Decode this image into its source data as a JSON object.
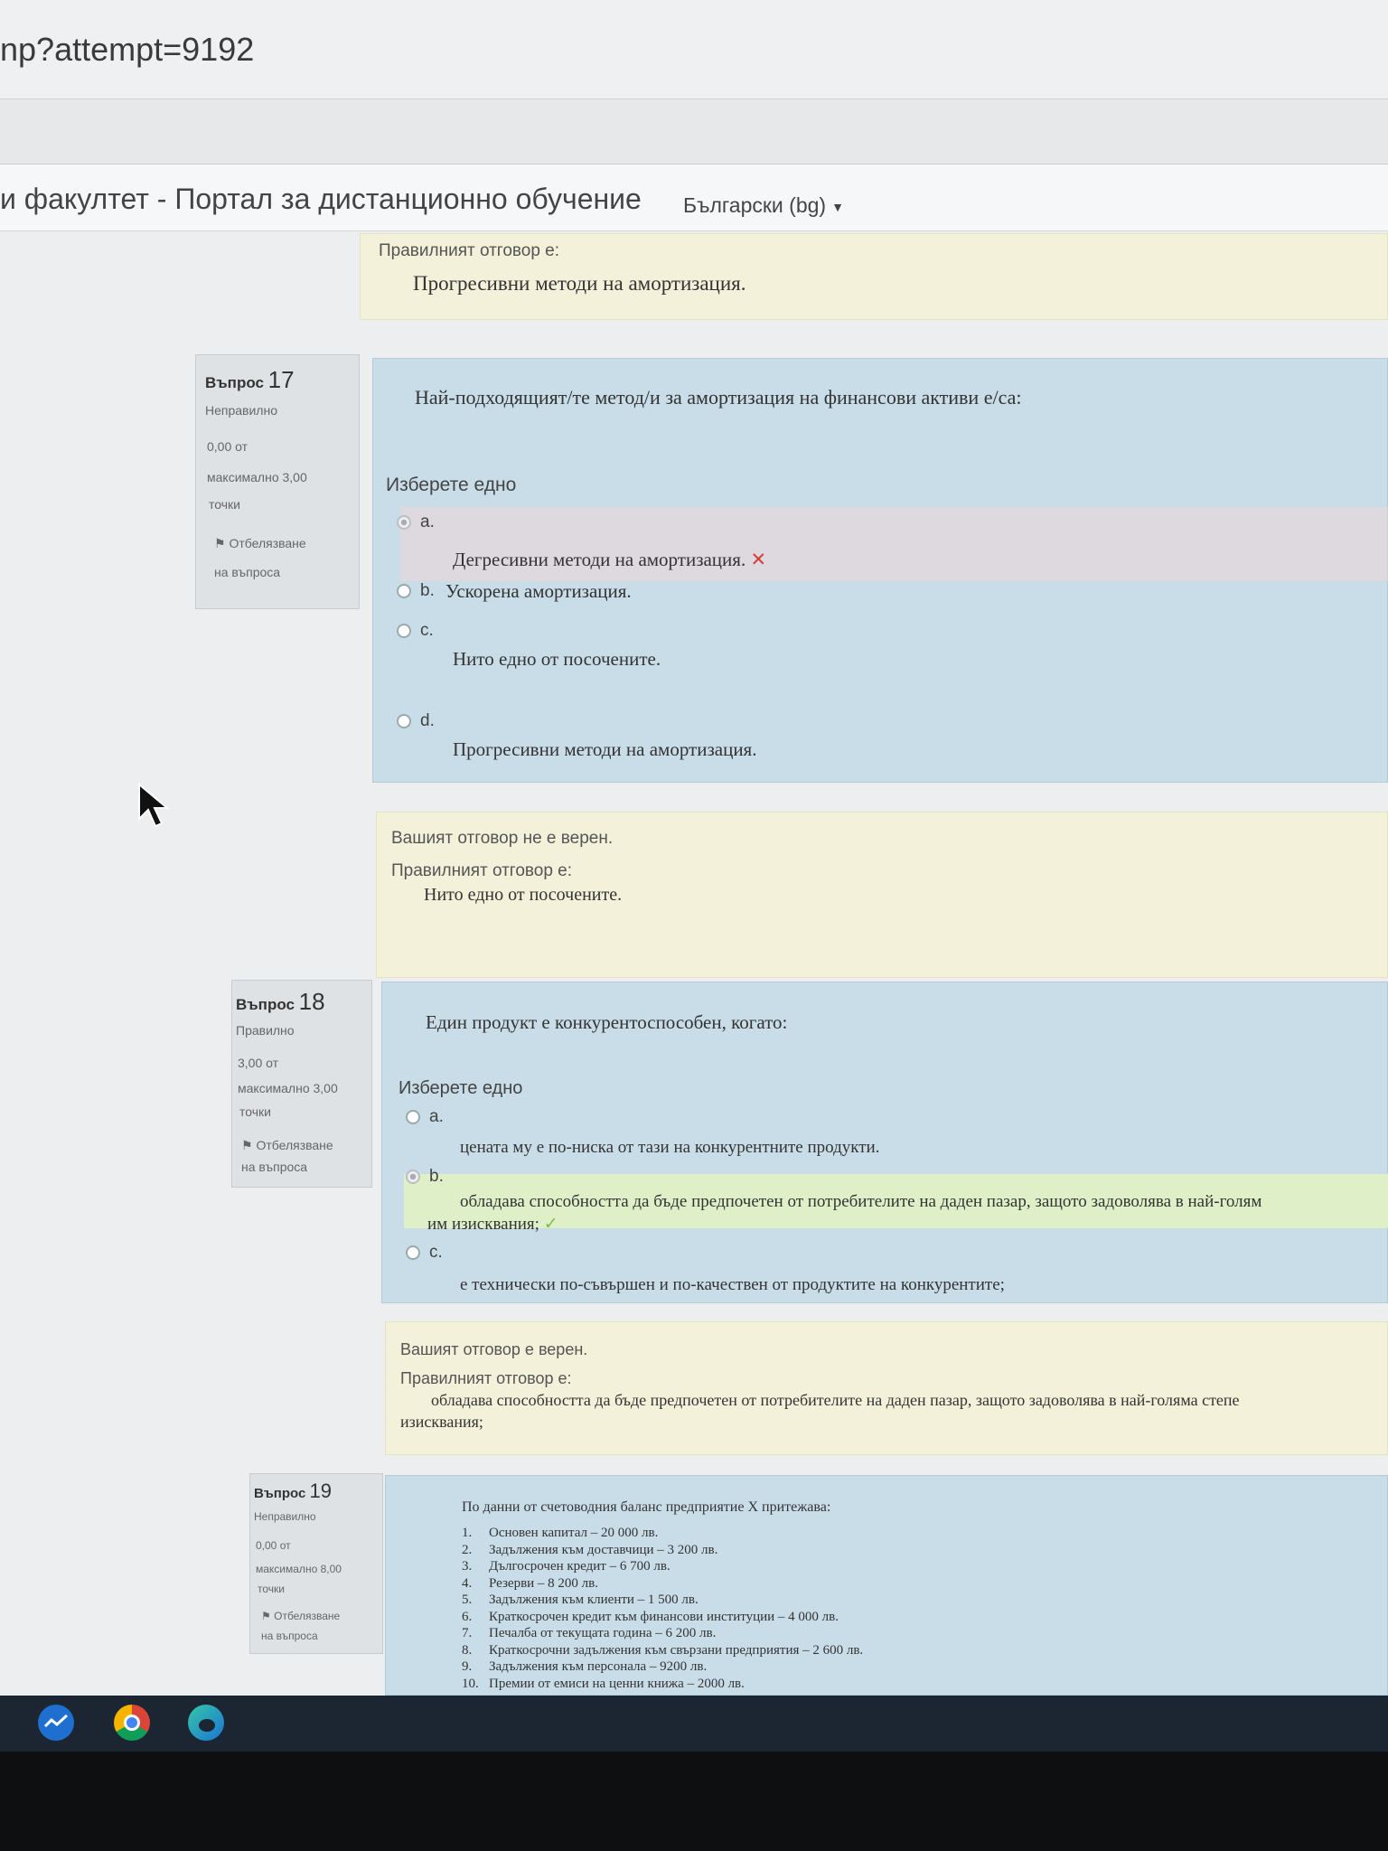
{
  "browser": {
    "url": "np?attempt=9192"
  },
  "site": {
    "name": "и факултет - Портал за дистанционно обучение",
    "language": "Български (bg)"
  },
  "prev_feedback": {
    "label": "Правилният отговор е:",
    "answer": "Прогресивни методи на амортизация."
  },
  "q17": {
    "label": "Въпрос",
    "number": "17",
    "status": "Неправилно",
    "score": "0,00 от",
    "max": "максимално 3,00",
    "points": "точки",
    "flag": "Отбелязване",
    "flag2": "на въпроса",
    "text": "Най-подходящият/те метод/и за амортизация на финансови активи е/са:",
    "choose": "Изберете едно",
    "options": [
      {
        "letter": "a.",
        "text": "Дегресивни методи на амортизация."
      },
      {
        "letter": "b.",
        "text": "Ускорена амортизация."
      },
      {
        "letter": "c.",
        "text": "Нито едно от посочените."
      },
      {
        "letter": "d.",
        "text": "Прогресивни методи на амортизация."
      }
    ],
    "feedback_result": "Вашият отговор не е верен.",
    "feedback_label": "Правилният отговор е:",
    "feedback_answer": "Нито едно от посочените."
  },
  "q18": {
    "label": "Въпрос",
    "number": "18",
    "status": "Правилно",
    "score": "3,00 от",
    "max": "максимално 3,00",
    "points": "точки",
    "flag": "Отбелязване",
    "flag2": "на въпроса",
    "text": "Един продукт е конкурентоспособен, когато:",
    "choose": "Изберете едно",
    "options": [
      {
        "letter": "a.",
        "text": "цената му е по-ниска от тази на конкурентните продукти."
      },
      {
        "letter": "b.",
        "text": "обладава способността да бъде предпочетен от потребителите на даден пазар, защото задоволява в най-голям",
        "text2": "им изисквания;"
      },
      {
        "letter": "c.",
        "text": "е технически по-съвършен и по-качествен от продуктите на конкурентите;"
      }
    ],
    "feedback_result": "Вашият отговор е верен.",
    "feedback_label": "Правилният отговор е:",
    "feedback_answer": "обладава способността да бъде предпочетен от потребителите на даден пазар, защото задоволява в най-голяма степе",
    "feedback_answer2": "изисквания;"
  },
  "q19": {
    "label": "Въпрос",
    "number": "19",
    "status": "Неправилно",
    "score": "0,00 от",
    "max": "максимално 8,00",
    "points": "точки",
    "flag": "Отбелязване",
    "flag2": "на въпроса",
    "text": "По данни от счетоводния баланс предприятие X притежава:",
    "items": [
      {
        "n": "1.",
        "t": "Основен капитал – 20 000 лв."
      },
      {
        "n": "2.",
        "t": "Задължения към доставчици – 3 200 лв."
      },
      {
        "n": "3.",
        "t": "Дългосрочен кредит – 6 700 лв."
      },
      {
        "n": "4.",
        "t": "Резерви – 8 200 лв."
      },
      {
        "n": "5.",
        "t": "Задължения към клиенти – 1 500 лв."
      },
      {
        "n": "6.",
        "t": "Краткосрочен кредит към финансови институции – 4 000 лв."
      },
      {
        "n": "7.",
        "t": "Печалба от текущата година – 6 200 лв."
      },
      {
        "n": "8.",
        "t": "Краткосрочни задължения към свързани предприятия – 2 600 лв."
      },
      {
        "n": "9.",
        "t": "Задължения към персонала – 9200 лв."
      },
      {
        "n": "10.",
        "t": "Премии от емиси на ценни книжа – 2000 лв."
      }
    ]
  },
  "colors": {
    "question_bg": "#c9dde8",
    "feedback_bg": "#f3f1d9",
    "incorrect_mark": "#d93a3a",
    "correct_mark": "#7bbf4a"
  },
  "taskbar_icons": [
    "stocks-icon",
    "chrome-icon",
    "edge-icon"
  ]
}
